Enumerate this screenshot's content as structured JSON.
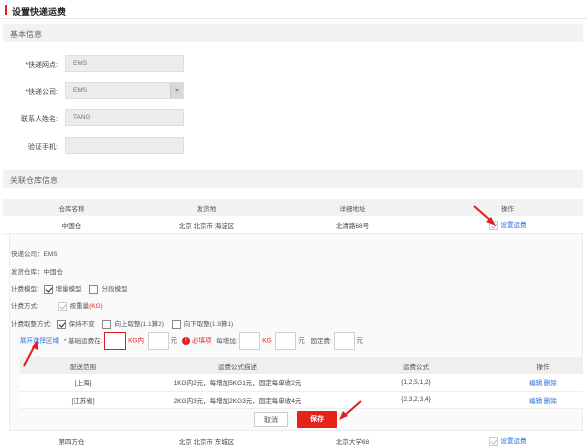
{
  "page_title": "设置快递运费",
  "sections": {
    "basic": "基本信息",
    "warehouse": "关联仓库信息"
  },
  "basic_fields": [
    {
      "label": "快递网点:",
      "required": "*",
      "value": "EMS"
    },
    {
      "label": "快递公司:",
      "required": "*",
      "value": "EMS"
    },
    {
      "label": "联系人姓名:",
      "required": "",
      "value": "TANG"
    },
    {
      "label": "验证手机:",
      "required": "",
      "value": ""
    }
  ],
  "warehouse_table": {
    "headers": [
      "仓库名称",
      "发货地",
      "详细地址",
      "操作"
    ],
    "rows": [
      {
        "name": "中国仓",
        "origin": "北京 北京市 海淀区",
        "address": "北清路68号",
        "action": "设置运费"
      },
      {
        "name": "第四方仓",
        "origin": "北京 北京市 东城区",
        "address": "北京大学68",
        "action": "设置运费"
      }
    ]
  },
  "panel": {
    "company": "快递公司：EMS",
    "warehouse": "发货仓库：中国仓",
    "model_label": "计费模型:",
    "model_opts": [
      "增量模型",
      "分段模型"
    ],
    "method_label": "计费方式:",
    "method_value": "按重量",
    "method_unit": "(KG)",
    "round_label": "计费取整方式:",
    "round_opts": [
      "保持不变",
      "向上取整(1.1算2)",
      "向下取整(1.9算1)"
    ],
    "expand_link": "展开选择区域",
    "base_label": "* 基础运费在:",
    "base_unit": "KG内",
    "yuan": "元",
    "required_tip": "必填项",
    "incr_label": "每增加:",
    "kg": "KG",
    "fixed_label": "固定费:"
  },
  "rules_table": {
    "headers": [
      "配送范围",
      "运费公式描述",
      "运费公式",
      "操作"
    ],
    "rows": [
      {
        "area": "[上海]",
        "desc": "1KG内2元，每增加5KG1元，固定每单收2元",
        "formula": "{1,2,5,1,2}",
        "edit": "编辑",
        "del": "删除"
      },
      {
        "area": "[江苏省]",
        "desc": "2KG内3元，每增加2KG3元，固定每单收4元",
        "formula": "{2,3,2,3,4}",
        "edit": "编辑",
        "del": "删除"
      }
    ]
  },
  "buttons": {
    "cancel": "取消",
    "save": "保存"
  },
  "colors": {
    "accent": "#e6231b",
    "link": "#2a6fd6"
  }
}
